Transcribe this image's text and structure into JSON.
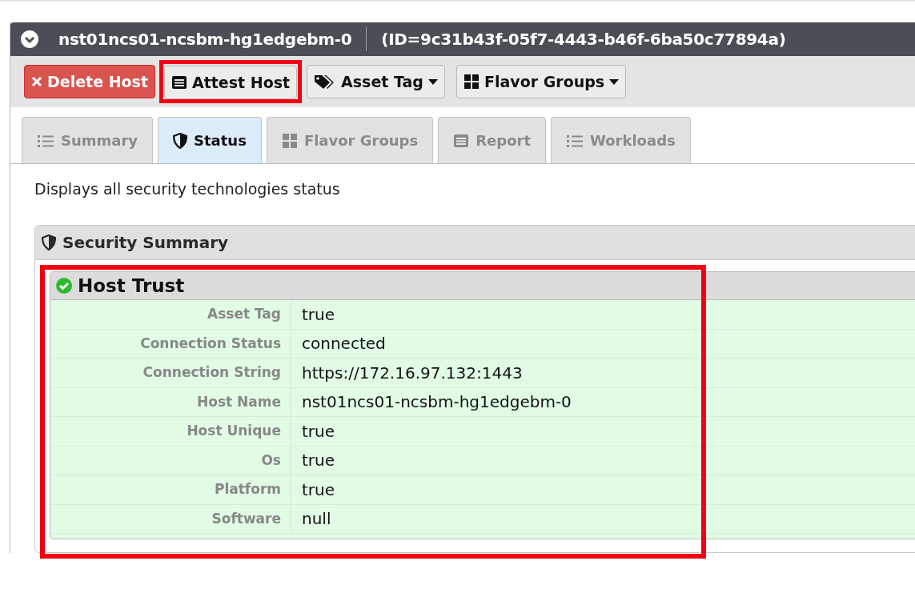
{
  "panel": {
    "title": "nst01ncs01-ncsbm-hg1edgebm-0",
    "id_text": "(ID=9c31b43f-05f7-4443-b46f-6ba50c77894a)",
    "expanded": true
  },
  "toolbar": [
    {
      "label": "Delete Host",
      "kind": "danger",
      "dropdown": false,
      "highlighted": false
    },
    {
      "label": "Attest Host",
      "kind": "normal",
      "dropdown": false,
      "highlighted": true
    },
    {
      "label": "Asset Tag",
      "kind": "normal",
      "dropdown": true,
      "highlighted": false
    },
    {
      "label": "Flavor Groups",
      "kind": "normal",
      "dropdown": true,
      "highlighted": false
    }
  ],
  "tabs": [
    {
      "label": "Summary",
      "selected": false
    },
    {
      "label": "Status",
      "selected": true
    },
    {
      "label": "Flavor Groups",
      "selected": false
    },
    {
      "label": "Report",
      "selected": false
    },
    {
      "label": "Workloads",
      "selected": false
    }
  ],
  "description": "Displays all security technologies status",
  "security_summary": {
    "title": "Security Summary",
    "host_trust": {
      "title": "Host Trust",
      "trusted": true,
      "highlighted": true,
      "rows": [
        {
          "label": "Asset Tag",
          "value": "true"
        },
        {
          "label": "Connection Status",
          "value": "connected"
        },
        {
          "label": "Connection String",
          "value": "https://172.16.97.132:1443"
        },
        {
          "label": "Host Name",
          "value": "nst01ncs01-ncsbm-hg1edgebm-0"
        },
        {
          "label": "Host Unique",
          "value": "true"
        },
        {
          "label": "Os",
          "value": "true"
        },
        {
          "label": "Platform",
          "value": "true"
        },
        {
          "label": "Software",
          "value": "null"
        }
      ]
    }
  }
}
